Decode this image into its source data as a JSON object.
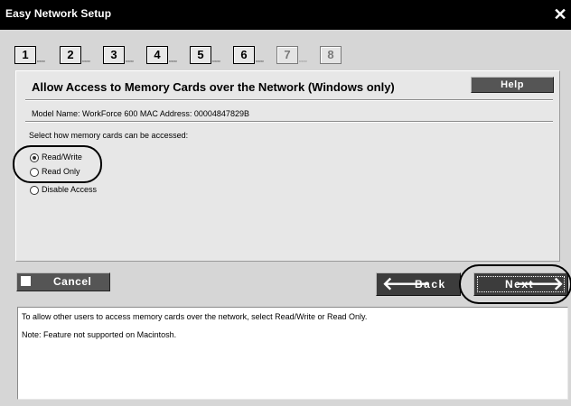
{
  "window": {
    "title": "Easy Network Setup",
    "close_glyph": "✕"
  },
  "steps": [
    {
      "num": "1",
      "dots": "▫▫▫",
      "active": true
    },
    {
      "num": "2",
      "dots": "▫▫▫",
      "active": true
    },
    {
      "num": "3",
      "dots": "▫▫▫",
      "active": true
    },
    {
      "num": "4",
      "dots": "▫▫▫",
      "active": true
    },
    {
      "num": "5",
      "dots": "▫▫▫",
      "active": true
    },
    {
      "num": "6",
      "dots": "▫▫▫",
      "active": true
    },
    {
      "num": "7",
      "dots": "▫▫▫",
      "active": false
    },
    {
      "num": "8",
      "dots": "",
      "active": false
    }
  ],
  "panel": {
    "heading": "Allow Access to Memory Cards over the Network (Windows only)",
    "help_label": "Help",
    "model_info": "Model Name: WorkForce 600    MAC Address: 00004847829B",
    "instruction": "Select how memory cards can be accessed:",
    "options": [
      {
        "label": "Read/Write",
        "selected": true
      },
      {
        "label": "Read Only",
        "selected": false
      },
      {
        "label": "Disable Access",
        "selected": false
      }
    ]
  },
  "buttons": {
    "cancel_label": "Cancel",
    "back_label": "Back",
    "back_icon": "🡐",
    "next_label": "Next",
    "next_icon": "🡒"
  },
  "description": {
    "line1": "To allow other users to access memory cards over the network, select Read/Write or Read Only.",
    "line2": "Note: Feature not supported on Macintosh."
  }
}
